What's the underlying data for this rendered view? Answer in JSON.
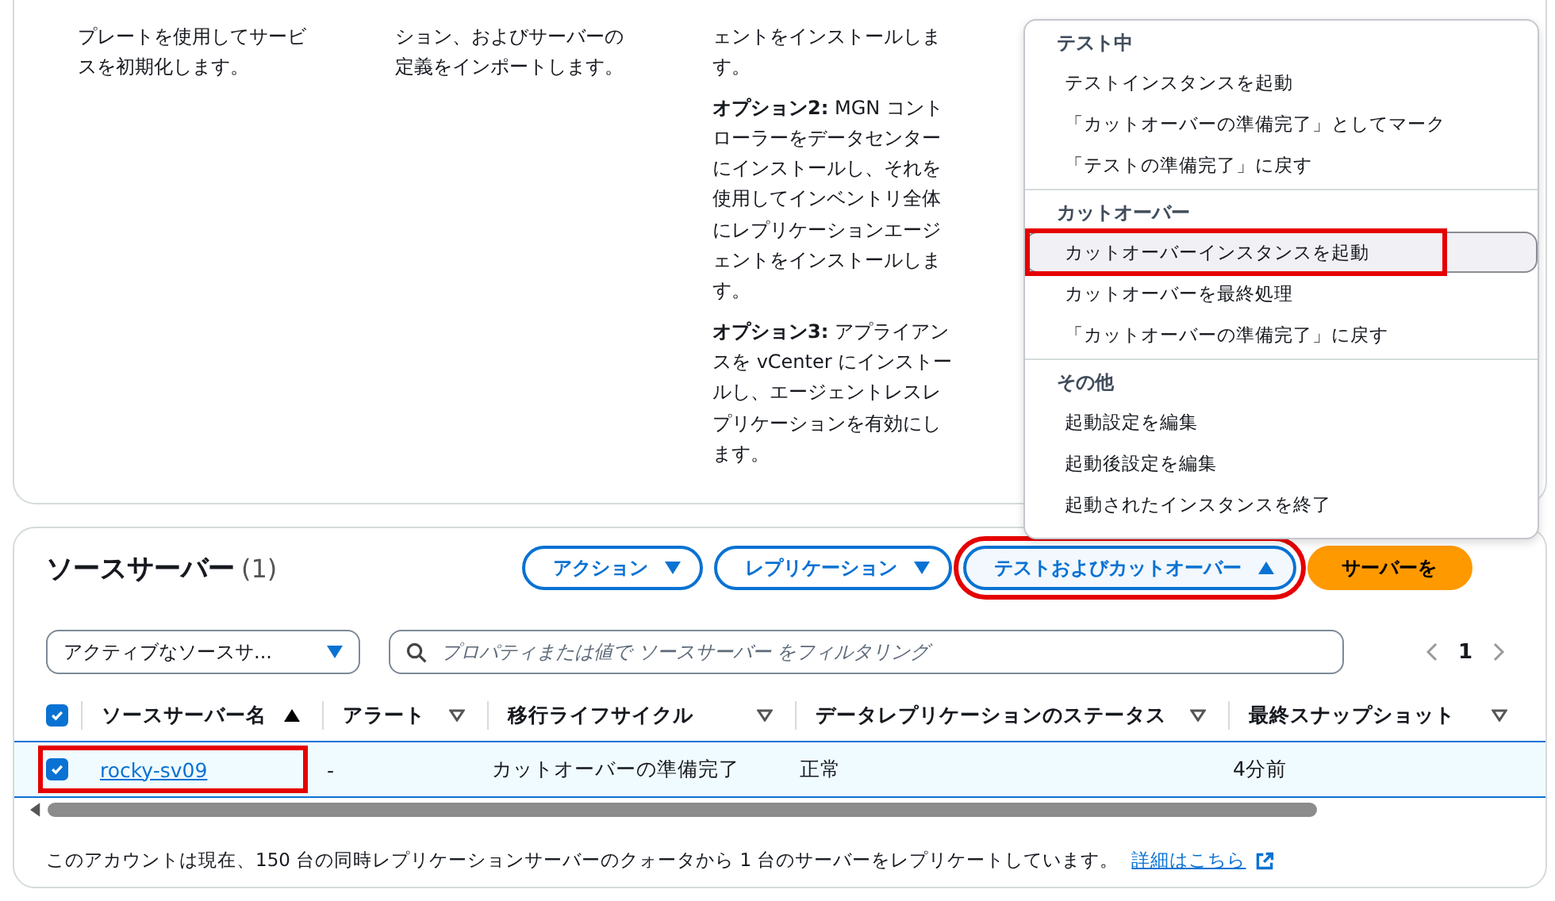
{
  "intro_columns": [
    {
      "paragraphs": [
        "プレートを使用してサービスを初期化します。"
      ]
    },
    {
      "paragraphs": [
        "ション、およびサーバーの定義をインポートします。"
      ]
    },
    {
      "paragraphs": [
        "ェントをインストールします。",
        "**オプション2:** MGN コントローラーをデータセンターにインストールし、それを使用してインベントリ全体にレプリケーションエージェントをインストールします。",
        "**オプション3:** アプライアンスを vCenter にインストールし、エージェントレスレプリケーションを有効にします。"
      ]
    }
  ],
  "menu": {
    "groups": [
      {
        "heading": "テスト中",
        "items": [
          {
            "label": "テストインスタンスを起動",
            "selected": false,
            "annotated": false
          },
          {
            "label": "「カットオーバーの準備完了」としてマーク",
            "selected": false,
            "annotated": false
          },
          {
            "label": "「テストの準備完了」に戻す",
            "selected": false,
            "annotated": false
          }
        ]
      },
      {
        "heading": "カットオーバー",
        "items": [
          {
            "label": "カットオーバーインスタンスを起動",
            "selected": true,
            "annotated": true
          },
          {
            "label": "カットオーバーを最終処理",
            "selected": false,
            "annotated": false
          },
          {
            "label": "「カットオーバーの準備完了」に戻す",
            "selected": false,
            "annotated": false
          }
        ]
      },
      {
        "heading": "その他",
        "items": [
          {
            "label": "起動設定を編集",
            "selected": false,
            "annotated": false
          },
          {
            "label": "起動後設定を編集",
            "selected": false,
            "annotated": false
          },
          {
            "label": "起動されたインスタンスを終了",
            "selected": false,
            "annotated": false
          }
        ]
      }
    ]
  },
  "panel": {
    "title": "ソースサーバー",
    "count": "(1)",
    "buttons": [
      {
        "label": "アクション",
        "kind": "dropdown",
        "expanded": false,
        "annotated": false
      },
      {
        "label": "レプリケーション",
        "kind": "dropdown",
        "expanded": false,
        "annotated": false
      },
      {
        "label": "テストおよびカットオーバー",
        "kind": "dropdown",
        "expanded": true,
        "annotated": true
      },
      {
        "label": "サーバーを",
        "kind": "primary"
      }
    ],
    "filter_select": "アクティブなソースサ...",
    "search": {
      "placeholder": "プロパティまたは値で ソースサーバー をフィルタリング"
    },
    "page": "1",
    "table": {
      "all_checked": true,
      "columns": [
        {
          "label": "ソースサーバー名",
          "sorted": true
        },
        {
          "label": "アラート",
          "sorted": false
        },
        {
          "label": "移行ライフサイクル",
          "sorted": false
        },
        {
          "label": "データレプリケーションのステータス",
          "sorted": false
        },
        {
          "label": "最終スナップショット",
          "sorted": false
        }
      ],
      "rows": [
        {
          "selected": true,
          "annotated": true,
          "name": "rocky-sv09",
          "alert": "-",
          "lifecycle": "カットオーバーの準備完了",
          "status": "正常",
          "snapshot": "4分前"
        }
      ]
    },
    "footer": {
      "text": "このアカウントは現在、150 台の同時レプリケーションサーバーのクォータから 1 台のサーバーをレプリケートしています。",
      "link": "詳細はこちら"
    }
  }
}
